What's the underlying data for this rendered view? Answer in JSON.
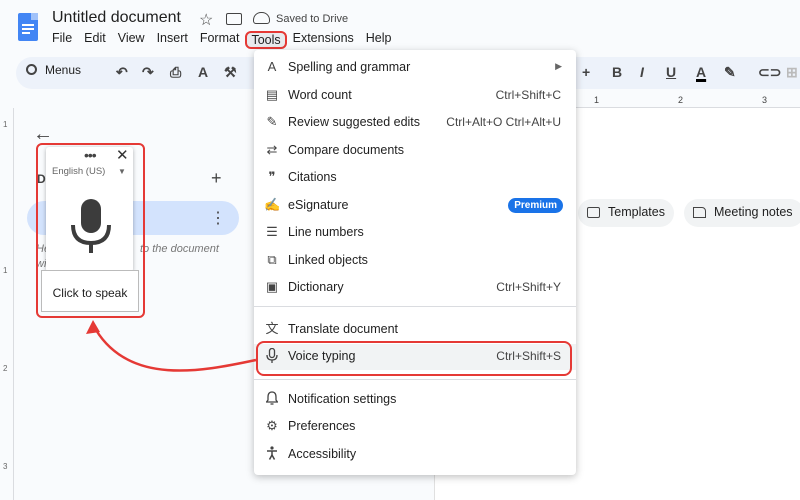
{
  "header": {
    "doc_title": "Untitled document",
    "saved_status": "Saved to Drive"
  },
  "menubar": [
    "File",
    "Edit",
    "View",
    "Insert",
    "Format",
    "Tools",
    "Extensions",
    "Help"
  ],
  "toolbar": {
    "search_label": "Menus"
  },
  "ruler": {
    "ticks": [
      "1",
      "2",
      "3"
    ],
    "vticks": [
      "1",
      "1",
      "2",
      "3"
    ]
  },
  "panel": {
    "tab_letter": "D",
    "hint_left": "He",
    "hint_right": "to the document",
    "hint_left2": "wi"
  },
  "chips": {
    "templates": "Templates",
    "meeting_notes": "Meeting notes"
  },
  "voice_widget": {
    "language": "English (US)",
    "speak_label": "Click to speak"
  },
  "tools_menu": {
    "items": [
      {
        "icon": "spellcheck-icon",
        "glyph": "A",
        "label": "Spelling and grammar",
        "shortcut": ""
      },
      {
        "icon": "word-count-icon",
        "glyph": "▤",
        "label": "Word count",
        "shortcut": "Ctrl+Shift+C"
      },
      {
        "icon": "review-edits-icon",
        "glyph": "✎",
        "label": "Review suggested edits",
        "shortcut": "Ctrl+Alt+O Ctrl+Alt+U"
      },
      {
        "icon": "compare-icon",
        "glyph": "⇄",
        "label": "Compare documents",
        "shortcut": ""
      },
      {
        "icon": "citations-icon",
        "glyph": "❞",
        "label": "Citations",
        "shortcut": ""
      },
      {
        "icon": "esignature-icon",
        "glyph": "✍",
        "label": "eSignature",
        "shortcut": "",
        "badge": "Premium"
      },
      {
        "icon": "line-numbers-icon",
        "glyph": "☰",
        "label": "Line numbers",
        "shortcut": ""
      },
      {
        "icon": "linked-objects-icon",
        "glyph": "⧉",
        "label": "Linked objects",
        "shortcut": ""
      },
      {
        "icon": "dictionary-icon",
        "glyph": "▣",
        "label": "Dictionary",
        "shortcut": "Ctrl+Shift+Y"
      },
      {
        "icon": "translate-icon",
        "glyph": "文",
        "label": "Translate document",
        "shortcut": ""
      },
      {
        "icon": "mic-icon",
        "glyph": "🎙",
        "label": "Voice typing",
        "shortcut": "Ctrl+Shift+S"
      },
      {
        "icon": "bell-icon",
        "glyph": "🔔",
        "label": "Notification settings",
        "shortcut": ""
      },
      {
        "icon": "preferences-icon",
        "glyph": "⚙",
        "label": "Preferences",
        "shortcut": ""
      },
      {
        "icon": "accessibility-icon",
        "glyph": "♿",
        "label": "Accessibility",
        "shortcut": ""
      }
    ]
  },
  "colors": {
    "highlight": "#e53935",
    "accent": "#1a73e8",
    "selected_tab": "#d3e3fd"
  }
}
